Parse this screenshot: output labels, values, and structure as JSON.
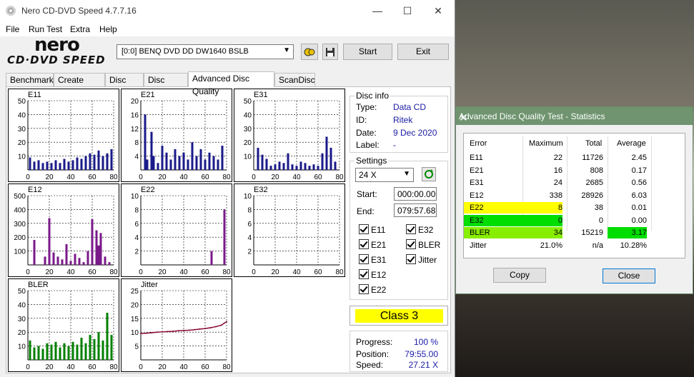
{
  "window": {
    "title": "Nero CD-DVD Speed 4.7.7.16",
    "minimize": "—",
    "maximize": "☐",
    "close": "✕"
  },
  "menu": [
    "File",
    "Run Test",
    "Extra",
    "Help"
  ],
  "logo": {
    "main": "nero",
    "sub": "CD·DVD SPEED"
  },
  "toolbar": {
    "drive": "[0:0]   BENQ DVD DD DW1640 BSLB",
    "start": "Start",
    "exit": "Exit"
  },
  "tabs": [
    "Benchmark",
    "Create Disc",
    "Disc Info",
    "Disc Quality",
    "Advanced Disc Quality",
    "ScanDisc"
  ],
  "disc_info": {
    "heading": "Disc info",
    "type_label": "Type:",
    "type": "Data CD",
    "id_label": "ID:",
    "id": "Ritek",
    "date_label": "Date:",
    "date": "9 Dec 2020",
    "label_label": "Label:",
    "label": "-"
  },
  "settings": {
    "heading": "Settings",
    "speed": "24 X",
    "start_label": "Start:",
    "start": "000:00.00",
    "end_label": "End:",
    "end": "079:57.68"
  },
  "checks": [
    "E11",
    "E32",
    "E21",
    "BLER",
    "E31",
    "Jitter",
    "E12",
    "E22"
  ],
  "class": "Class 3",
  "progress": {
    "progress_label": "Progress:",
    "progress": "100 %",
    "position_label": "Position:",
    "position": "79:55.00",
    "speed_label": "Speed:",
    "speed": "27.21 X"
  },
  "colors": {
    "bar_color": "#1a1a8a",
    "e12_color": "#7a1a8a",
    "bler_color": "#008000",
    "jitter_color": "#8a0a3a",
    "yellow": "#ffff00",
    "green": "#00dd00",
    "lightgreen": "#88ee00"
  },
  "dialog": {
    "title": "Advanced Disc Quality Test - Statistics",
    "headers": [
      "Error",
      "Maximum",
      "Total",
      "Average"
    ],
    "rows": [
      [
        "E11",
        "22",
        "11726",
        "2.45"
      ],
      [
        "E21",
        "16",
        "808",
        "0.17"
      ],
      [
        "E31",
        "24",
        "2685",
        "0.56"
      ],
      [
        "E12",
        "338",
        "28926",
        "6.03"
      ],
      [
        "E22",
        "8",
        "38",
        "0.01"
      ],
      [
        "E32",
        "0",
        "0",
        "0.00"
      ],
      [
        "BLER",
        "34",
        "15219",
        "3.17"
      ],
      [
        "Jitter",
        "21.0%",
        "n/a",
        "10.28%"
      ]
    ],
    "copy": "Copy",
    "close": "Close"
  },
  "chart_data": [
    {
      "type": "bar",
      "title": "E11",
      "ylim": [
        0,
        50
      ],
      "yticks": [
        "50",
        "40",
        "30",
        "20",
        "10"
      ],
      "xticks": [
        "0",
        "20",
        "40",
        "60",
        "80"
      ],
      "x": [
        2,
        6,
        10,
        14,
        18,
        22,
        26,
        30,
        34,
        38,
        42,
        46,
        50,
        54,
        58,
        62,
        66,
        70,
        74,
        78
      ],
      "values": [
        9,
        6,
        7,
        5,
        6,
        5,
        7,
        5,
        8,
        6,
        7,
        9,
        8,
        10,
        12,
        11,
        14,
        10,
        12,
        15
      ]
    },
    {
      "type": "bar",
      "title": "E21",
      "ylim": [
        0,
        20
      ],
      "yticks": [
        "20",
        "16",
        "12",
        "8",
        "4"
      ],
      "xticks": [
        "0",
        "20",
        "40",
        "60",
        "80"
      ],
      "x": [
        4,
        6,
        10,
        12,
        16,
        20,
        24,
        28,
        32,
        36,
        40,
        44,
        48,
        52,
        56,
        60,
        64,
        68,
        72,
        76
      ],
      "values": [
        16,
        3,
        11,
        4,
        2,
        7,
        5,
        3,
        6,
        4,
        5,
        3,
        8,
        4,
        6,
        3,
        5,
        4,
        3,
        7
      ]
    },
    {
      "type": "bar",
      "title": "E31",
      "ylim": [
        0,
        50
      ],
      "yticks": [
        "50",
        "40",
        "30",
        "20",
        "10"
      ],
      "xticks": [
        "0",
        "20",
        "40",
        "60",
        "80"
      ],
      "x": [
        4,
        8,
        12,
        16,
        20,
        24,
        28,
        32,
        36,
        40,
        44,
        48,
        52,
        56,
        60,
        64,
        68,
        72,
        76
      ],
      "values": [
        16,
        11,
        8,
        3,
        4,
        6,
        5,
        12,
        4,
        3,
        6,
        5,
        3,
        4,
        3,
        12,
        24,
        16,
        6
      ]
    },
    {
      "type": "bar",
      "title": "E12",
      "ylim": [
        0,
        500
      ],
      "yticks": [
        "500",
        "400",
        "300",
        "200",
        "100"
      ],
      "xticks": [
        "0",
        "20",
        "40",
        "60",
        "80"
      ],
      "x": [
        6,
        16,
        20,
        24,
        28,
        32,
        36,
        40,
        44,
        48,
        52,
        56,
        60,
        64,
        66,
        68,
        72,
        76
      ],
      "values": [
        180,
        60,
        338,
        90,
        60,
        40,
        150,
        30,
        80,
        50,
        20,
        100,
        330,
        250,
        140,
        230,
        60,
        20
      ]
    },
    {
      "type": "bar",
      "title": "E22",
      "ylim": [
        0,
        10
      ],
      "yticks": [
        "10",
        "8",
        "6",
        "4",
        "2"
      ],
      "xticks": [
        "0",
        "20",
        "40",
        "60",
        "80"
      ],
      "x": [
        66,
        78
      ],
      "values": [
        2,
        8
      ]
    },
    {
      "type": "bar",
      "title": "E32",
      "ylim": [
        0,
        10
      ],
      "yticks": [
        "10",
        "8",
        "6",
        "4",
        "2"
      ],
      "xticks": [
        "0",
        "20",
        "40",
        "60",
        "80"
      ],
      "x": [],
      "values": []
    },
    {
      "type": "bar",
      "title": "BLER",
      "ylim": [
        0,
        50
      ],
      "yticks": [
        "50",
        "40",
        "30",
        "20",
        "10"
      ],
      "xticks": [
        "0",
        "20",
        "40",
        "60",
        "80"
      ],
      "x": [
        2,
        6,
        10,
        14,
        18,
        22,
        26,
        30,
        34,
        38,
        42,
        46,
        50,
        54,
        58,
        62,
        66,
        70,
        74,
        78
      ],
      "values": [
        14,
        9,
        10,
        8,
        12,
        11,
        13,
        9,
        12,
        10,
        13,
        11,
        16,
        12,
        18,
        15,
        20,
        14,
        34,
        18
      ]
    },
    {
      "type": "line",
      "title": "Jitter",
      "ylim": [
        0,
        25
      ],
      "yticks": [
        "25",
        "20",
        "15",
        "10",
        "5"
      ],
      "xticks": [
        "0",
        "20",
        "40",
        "60",
        "80"
      ],
      "x": [
        0,
        5,
        10,
        15,
        20,
        25,
        30,
        35,
        40,
        45,
        50,
        55,
        60,
        65,
        70,
        75,
        80
      ],
      "values": [
        9.5,
        9.6,
        9.8,
        10,
        10.1,
        10.2,
        10.3,
        10.5,
        10.6,
        10.7,
        10.9,
        11.1,
        11.3,
        11.6,
        12,
        12.5,
        13.8
      ]
    }
  ]
}
